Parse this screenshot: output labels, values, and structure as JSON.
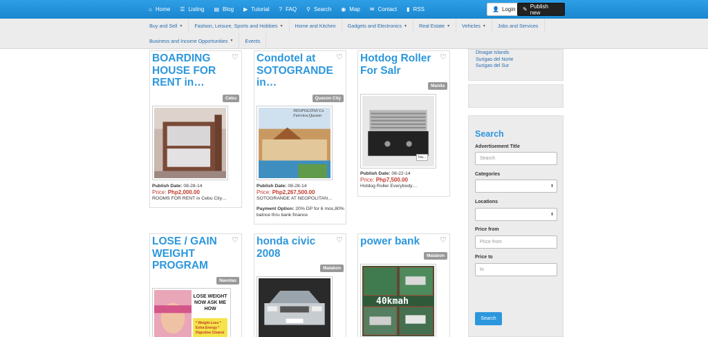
{
  "topnav": [
    {
      "label": "Home",
      "icon": "home-icon",
      "glyph": "⌂"
    },
    {
      "label": "Listing",
      "icon": "list-icon",
      "glyph": "☰"
    },
    {
      "label": "Blog",
      "icon": "document-icon",
      "glyph": "▤"
    },
    {
      "label": "Tutorial",
      "icon": "play-icon",
      "glyph": "▶"
    },
    {
      "label": "FAQ",
      "icon": "question-icon",
      "glyph": "?"
    },
    {
      "label": "Search",
      "icon": "search-icon",
      "glyph": "⚲"
    },
    {
      "label": "Map",
      "icon": "globe-icon",
      "glyph": "◉"
    },
    {
      "label": "Contact",
      "icon": "envelope-icon",
      "glyph": "✉"
    },
    {
      "label": "RSS",
      "icon": "signal-icon",
      "glyph": "▮"
    }
  ],
  "auth": {
    "login": "Login",
    "publish": "Publish new"
  },
  "categories_row1": [
    {
      "label": "Buy and Sell",
      "dropdown": true
    },
    {
      "label": "Fashion, Leisure, Sports and Hobbies",
      "dropdown": true
    },
    {
      "label": "Home and Kitchen",
      "dropdown": false
    },
    {
      "label": "Gadgets and Electronics",
      "dropdown": true
    },
    {
      "label": "Real Estate",
      "dropdown": true
    },
    {
      "label": "Vehicles",
      "dropdown": true
    },
    {
      "label": "Jobs and Services",
      "dropdown": false
    }
  ],
  "categories_row2": [
    {
      "label": "Business and Income Opportunities",
      "dropdown": true
    },
    {
      "label": "Events",
      "dropdown": false
    }
  ],
  "listings": [
    {
      "title": "BOARDING HOUSE FOR RENT in…",
      "location": "Cebu",
      "publish_label": "Publish Date:",
      "publish_date": "08-28-14",
      "price_label": "Price:",
      "price": "Php2,000.00",
      "desc": "ROOMS FOR RENT in Cebu City…",
      "extra_label": "",
      "extra": ""
    },
    {
      "title": "Condotel at SOTOGRANDE in…",
      "location": "Quezon City",
      "publish_label": "Publish Date:",
      "publish_date": "08-28-14",
      "price_label": "Price:",
      "price": "Php2,267,500.00",
      "desc": "SOTOGRANDE AT NEOPOLITAN…",
      "extra_label": "Payment Option:",
      "extra": "20% DP for 6 mos,80% balnce thru bank finance",
      "img_text": "NEOPOLITAN Co Fairview,Quezon"
    },
    {
      "title": "Hotdog Roller For Salr",
      "location": "Manila",
      "publish_label": "Publish Date:",
      "publish_date": "08-22-14",
      "price_label": "Price:",
      "price": "Php7,500.00",
      "desc": "Hotdog Roller Everybody…",
      "extra_label": "",
      "extra": ""
    },
    {
      "title": "LOSE / GAIN WEIGHT PROGRAM",
      "location": "Navotas",
      "img_text": "LOSE WEIGHT NOW ASK ME HOW",
      "img_list": "* Weight-Loss * Extra Energy * Digestive Cleansi"
    },
    {
      "title": "honda civic 2008",
      "location": "Malabon"
    },
    {
      "title": "power bank",
      "location": "Malabon",
      "img_text": "40kmah"
    }
  ],
  "sidebar_locations": [
    "Dinagat Islands",
    "Surigao del Norte",
    "Surigao del Sur"
  ],
  "search": {
    "title": "Search",
    "ad_title_label": "Advertisement Title",
    "ad_title_placeholder": "Search",
    "categories_label": "Categories",
    "locations_label": "Locations",
    "price_from_label": "Price from",
    "price_from_placeholder": "Price from",
    "price_to_label": "Price to",
    "price_to_placeholder": "to",
    "button": "Search"
  },
  "colors": {
    "accent": "#2c97dd",
    "topbar": "#1a86d0",
    "price": "#c0392b"
  }
}
